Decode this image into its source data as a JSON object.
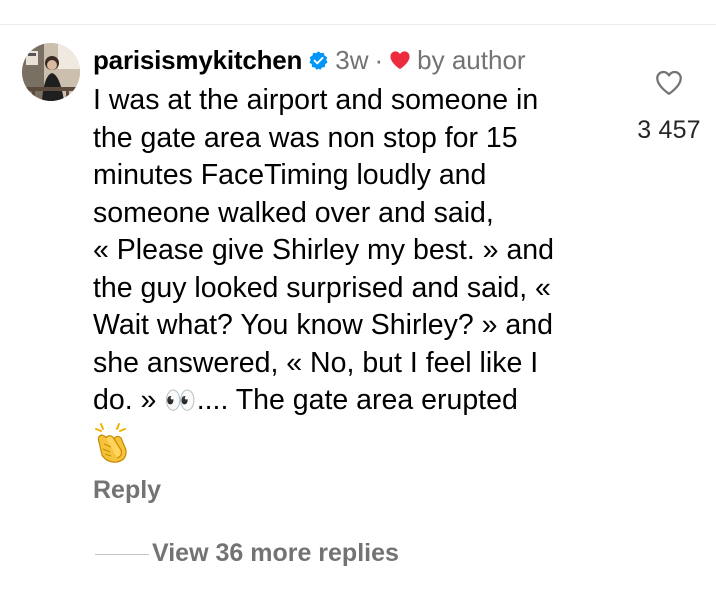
{
  "comment": {
    "username": "parisismykitchen",
    "time": "3w",
    "separator": "·",
    "by_author": "by author",
    "lines": [
      "I was at the airport and someone in",
      "the gate area was non stop for 15",
      "minutes FaceTiming loudly and",
      "someone walked over and said,",
      "« Please give Shirley my best. » and",
      "the guy looked surprised and said, «",
      "Wait what? You know Shirley? » and",
      "she answered, « No, but I feel like I"
    ],
    "last_line_before_emoji": "do. » ",
    "eyes_emoji": "👀",
    "last_line_after_emoji": ".... The gate area erupted",
    "clap_emoji": "👏",
    "reply_label": "Reply",
    "view_replies_label": "View 36 more replies"
  },
  "like": {
    "count": "3 457",
    "icon": "heart-outline-icon"
  },
  "colors": {
    "secondary_text": "#737373",
    "verified_blue": "#0095f6",
    "liked_red": "#ed2b3f"
  }
}
